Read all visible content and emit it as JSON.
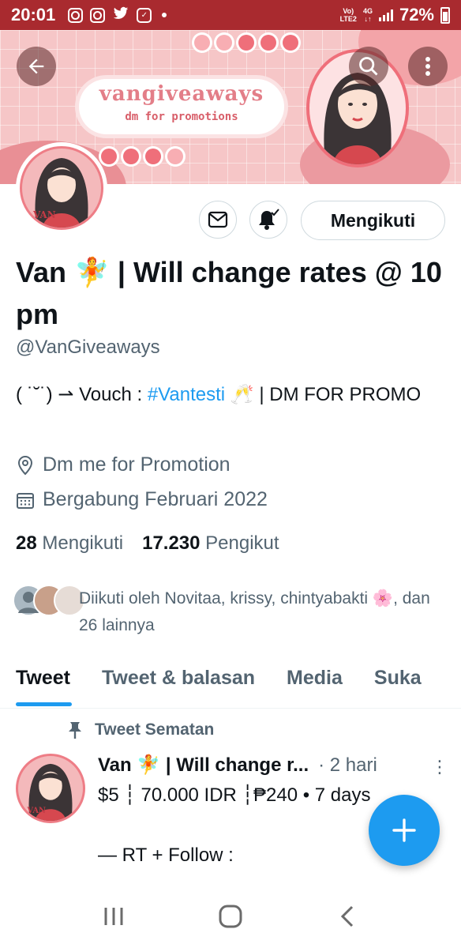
{
  "status_bar": {
    "time": "20:01",
    "network_top": "Vo)",
    "network_bottom": "LTE2",
    "network_type": "4G",
    "battery": "72%",
    "icons": [
      "instagram-icon",
      "instagram-icon",
      "twitter-icon",
      "checklist-icon",
      "dot-icon"
    ]
  },
  "banner": {
    "brand": "vangiveaways",
    "subtitle": "dm for promotions"
  },
  "header": {
    "back_icon": "arrow-left-icon",
    "search_icon": "search-icon",
    "more_icon": "more-vertical-icon"
  },
  "actions": {
    "message_icon": "mail-icon",
    "notify_icon": "bell-check-icon",
    "follow_label": "Mengikuti"
  },
  "profile": {
    "name": "Van 🧚 | Will change rates @ 10 pm",
    "handle": "@VanGiveaways",
    "bio_prefix": "( ˙˘˙) ⇀ Vouch : ",
    "bio_hashtag": "#Vantesti",
    "bio_suffix": " 🥂 | DM FOR PROMO",
    "location": "Dm me for Promotion",
    "joined": "Bergabung Februari 2022",
    "following_count": "28",
    "following_label": "Mengikuti",
    "followers_count": "17.230",
    "followers_label": "Pengikut",
    "followed_by": "Diikuti oleh Novitaa, krissy, chintyabakti 🌸, dan 26 lainnya"
  },
  "tabs": [
    "Tweet",
    "Tweet & balasan",
    "Media",
    "Suka"
  ],
  "active_tab": 0,
  "pinned_tweet": {
    "pinned_label": "Tweet Sematan",
    "author": "Van 🧚 | Will change r...",
    "time": "· 2 hari",
    "line1": "$5 ┆ 70.000 IDR ┆₱240 • 7 days",
    "line2": "— RT + Follow :"
  },
  "colors": {
    "accent": "#1d9bf0",
    "status_bar": "#a92a2f",
    "banner_pink": "#f6c6c7",
    "text_primary": "#0f1419",
    "text_secondary": "#536471"
  }
}
